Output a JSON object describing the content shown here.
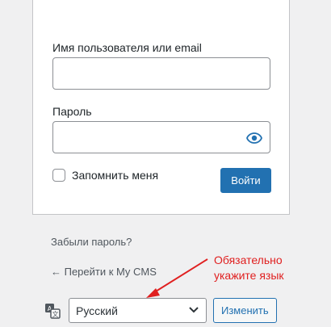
{
  "form": {
    "username_label": "Имя пользователя или email",
    "username_value": "",
    "password_label": "Пароль",
    "password_value": "",
    "remember_label": "Запомнить меня",
    "remember_checked": false,
    "submit_label": "Войти"
  },
  "links": {
    "lost_password": "Забыли пароль?",
    "back_to_site": "← Перейти к My CMS"
  },
  "annotation": {
    "line1": "Обязательно",
    "line2": "укажите язык",
    "color": "#e02020"
  },
  "language": {
    "icon": "translation-icon",
    "selected": "Русский",
    "change_label": "Изменить"
  },
  "colors": {
    "background": "#f0f0f1",
    "primary": "#2271b1",
    "text": "#1d2327"
  }
}
